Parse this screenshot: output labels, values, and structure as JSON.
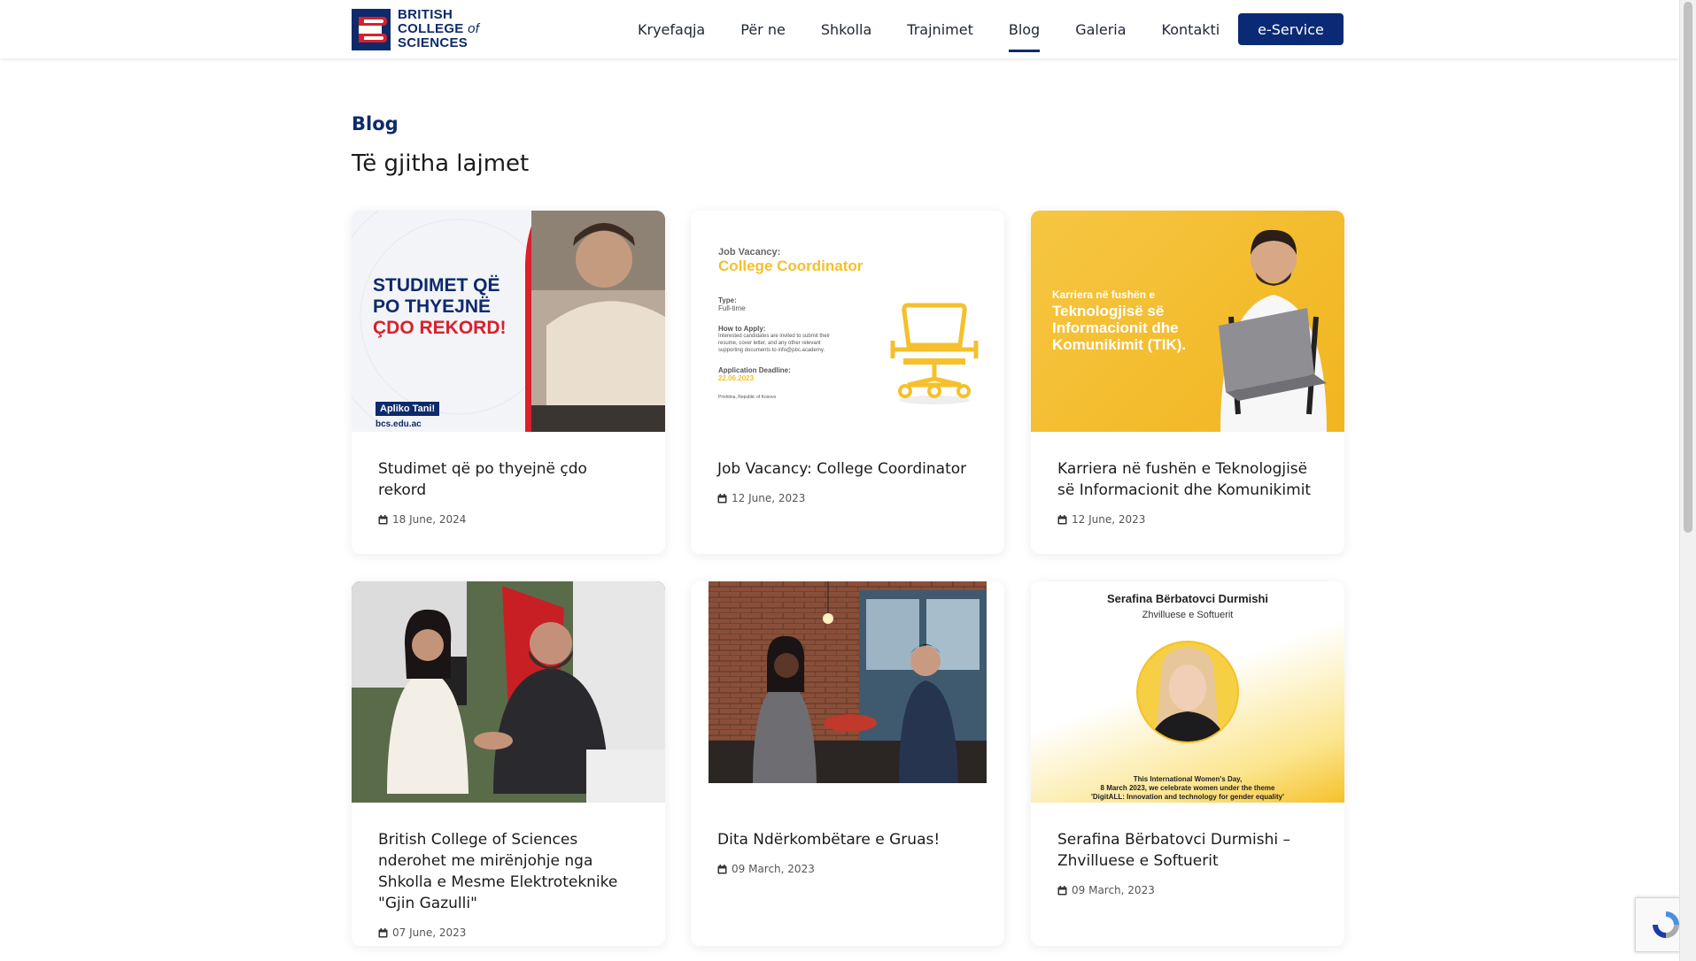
{
  "brand": {
    "line1": "BRITISH",
    "line2": "COLLEGE",
    "line2b": "of",
    "line3": "SCIENCES"
  },
  "nav": [
    {
      "label": "Kryefaqja",
      "active": false
    },
    {
      "label": "Për ne",
      "active": false
    },
    {
      "label": "Shkolla",
      "active": false
    },
    {
      "label": "Trajnimet",
      "active": false
    },
    {
      "label": "Blog",
      "active": true
    },
    {
      "label": "Galeria",
      "active": false
    },
    {
      "label": "Kontakti",
      "active": false
    }
  ],
  "eservice_label": "e-Service",
  "page": {
    "kicker": "Blog",
    "heading": "Të gjitha lajmet"
  },
  "posts": [
    {
      "title": "Studimet që po thyejnë çdo rekord",
      "date": "18 June, 2024",
      "image": {
        "headline1": "STUDIMET QË",
        "headline2": "PO THYEJNË",
        "headline3": "ÇDO REKORD!",
        "cta": "Apliko Tani!",
        "url": "bcs.edu.ac"
      }
    },
    {
      "title": "Job Vacancy: College Coordinator",
      "date": "12 June, 2023",
      "image": {
        "kicker": "Job Vacancy:",
        "headline": "College Coordinator",
        "type_label": "Type:",
        "type_value": "Full-time",
        "how_label": "How to Apply:",
        "how_text": "Interested candidates are invited to submit their resume, cover letter, and any other relevant supporting documents to info@pbc.academy.",
        "deadline_label": "Application Deadline:",
        "deadline_value": "22.06.2023",
        "location": "Prishtina, Republic of Kosovo"
      }
    },
    {
      "title": "Karriera në fushën e Teknologjisë së Informacionit dhe Komunikimit",
      "date": "12 June, 2023",
      "image": {
        "kicker": "Karriera në fushën e",
        "headline": "Teknologjisë së Informacionit dhe Komunikimit (TIK)."
      }
    },
    {
      "title": "British College of Sciences nderohet me mirënjohje nga Shkolla e Mesme Elektroteknike \"Gjin Gazulli\"",
      "date": "07 June, 2023"
    },
    {
      "title": "Dita Ndërkombëtare e Gruas!",
      "date": "09 March, 2023"
    },
    {
      "title": "Serafina Bërbatovci Durmishi – Zhvilluese e Softuerit",
      "date": "09 March, 2023",
      "image": {
        "name": "Serafina Bërbatovci Durmishi",
        "role": "Zhvilluese e Softuerit",
        "caption1": "This International Women's Day,",
        "caption2": "8 March 2023, we celebrate women under the theme",
        "caption3": "'DigitALL: Innovation and technology for gender equality'"
      }
    }
  ],
  "colors": {
    "brand_navy": "#0a2a75",
    "accent_red": "#d9202c",
    "accent_yellow": "#f5c02b"
  }
}
